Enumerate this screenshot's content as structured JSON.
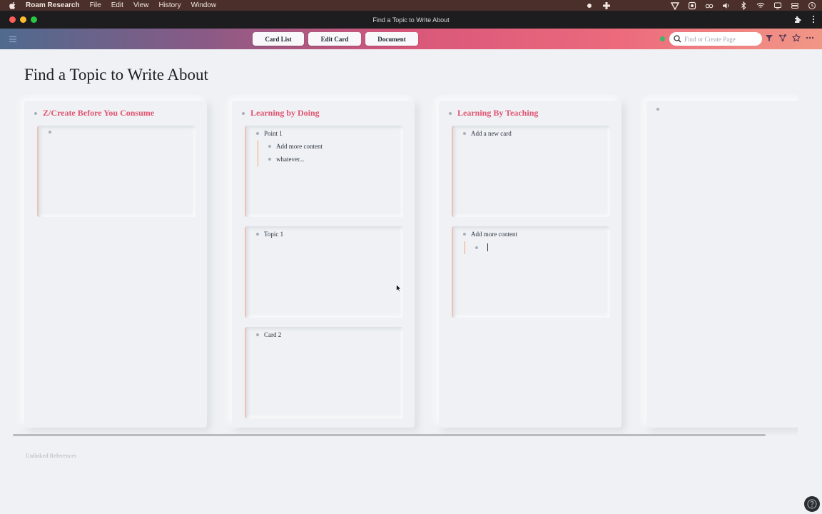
{
  "menubar": {
    "app_name": "Roam Research",
    "items": [
      "File",
      "Edit",
      "View",
      "History",
      "Window"
    ]
  },
  "window": {
    "title": "Find a Topic to Write About"
  },
  "topbar": {
    "views": [
      "Card List",
      "Edit Card",
      "Document"
    ],
    "search_placeholder": "Find or Create Page"
  },
  "page": {
    "title": "Find a Topic to Write About",
    "unlinked_label": "Unlinked References"
  },
  "columns": [
    {
      "title": "Z/Create Before You Consume",
      "cards": [
        {
          "blocks": [
            ""
          ]
        }
      ]
    },
    {
      "title": "Learning by Doing",
      "cards": [
        {
          "blocks": [
            "Point 1"
          ],
          "children": [
            "Add more content",
            "whatever..."
          ]
        },
        {
          "blocks": [
            "Topic 1"
          ]
        },
        {
          "blocks": [
            "Card 2"
          ]
        }
      ]
    },
    {
      "title": "Learning By Teaching",
      "cards": [
        {
          "blocks": [
            "Add a new card"
          ]
        },
        {
          "blocks": [
            "Add more content"
          ],
          "children": [
            ""
          ]
        }
      ]
    },
    {
      "title": "",
      "cards": []
    }
  ],
  "colors": {
    "accent": "#e05571",
    "thread": "#f2a882"
  }
}
